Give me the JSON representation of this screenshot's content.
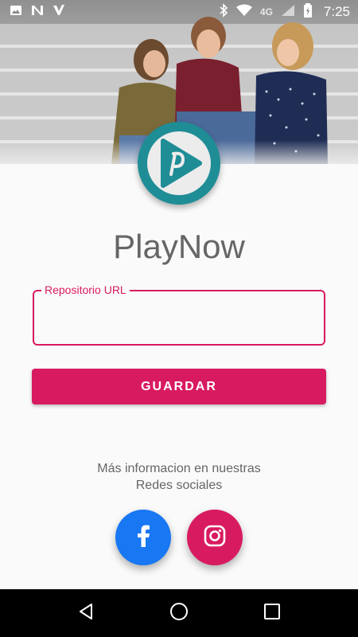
{
  "status_bar": {
    "time": "7:25",
    "network": "4G",
    "icons": [
      "image-icon",
      "n-icon",
      "check-icon",
      "bluetooth-icon",
      "wifi-icon",
      "signal-icon",
      "battery-icon"
    ]
  },
  "app": {
    "name": "PlayNow",
    "logo_icon": "playnow-logo-icon",
    "colors": {
      "accent": "#d81b60",
      "logo": "#1f8d96",
      "facebook": "#1877f2"
    }
  },
  "form": {
    "repo_label": "Repositorio URL",
    "repo_value": "",
    "save_label": "GUARDAR"
  },
  "info": {
    "line1": "Más informacion en nuestras",
    "line2": "Redes sociales"
  },
  "social": {
    "facebook_icon": "facebook-icon",
    "instagram_icon": "instagram-icon"
  },
  "nav": {
    "back_icon": "back-icon",
    "home_icon": "home-icon",
    "recents_icon": "recents-icon"
  }
}
